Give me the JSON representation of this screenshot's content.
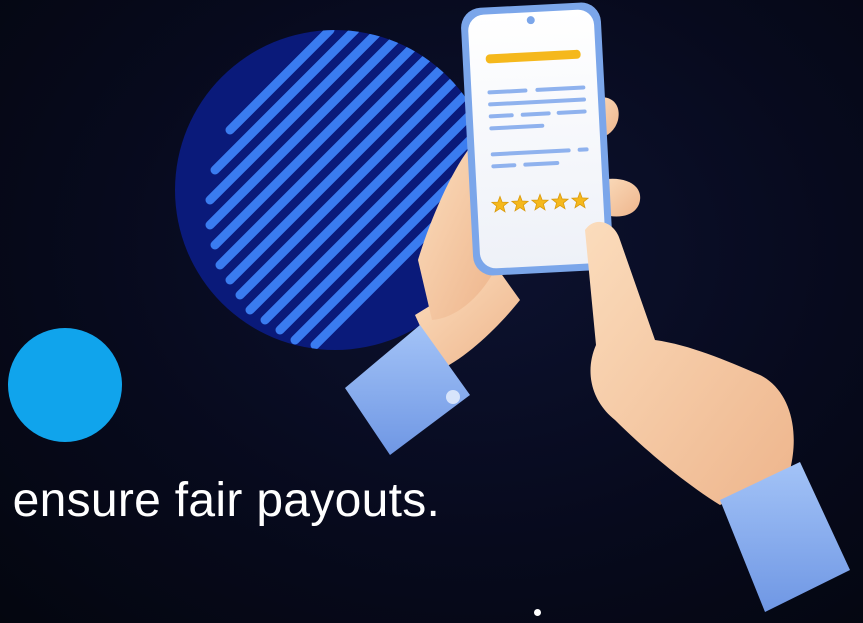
{
  "slide": {
    "caption": "l ensure fair payouts.",
    "colors": {
      "background": "#070a1d",
      "circle_navy": "#0a1a7a",
      "stripe_blue": "#3a7cf0",
      "accent_dot": "#10a4ec",
      "phone_frame": "#7ba6ea",
      "rating_star": "#f5b81c",
      "cuff_blue": "#8cb4f2",
      "skin": "#f7cfa8"
    },
    "phone": {
      "rating_stars": 5,
      "rating_icon": "star-icon"
    }
  }
}
